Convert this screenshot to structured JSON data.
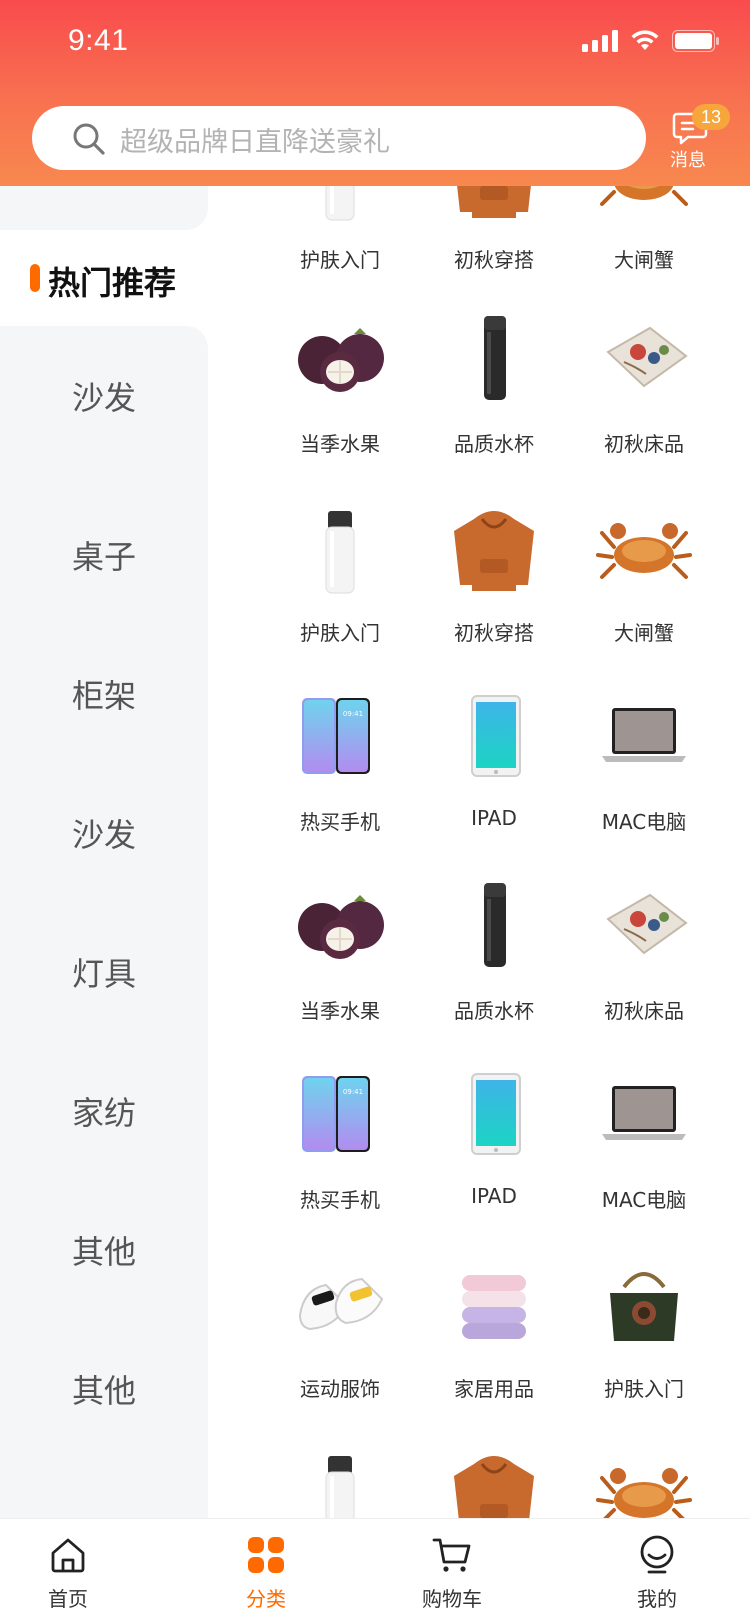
{
  "status_bar": {
    "time": "9:41"
  },
  "search": {
    "placeholder": "超级品牌日直降送豪礼"
  },
  "messages": {
    "label": "消息",
    "badge": "13"
  },
  "sidebar": {
    "active": "热门推荐",
    "items": [
      {
        "label": "沙发"
      },
      {
        "label": "桌子"
      },
      {
        "label": "柜架"
      },
      {
        "label": "沙发"
      },
      {
        "label": "灯具"
      },
      {
        "label": "家纺"
      },
      {
        "label": "其他"
      },
      {
        "label": "其他"
      }
    ]
  },
  "grid": {
    "rows": [
      [
        {
          "name": "护肤入门",
          "icon": "skincare-bottle"
        },
        {
          "name": "初秋穿搭",
          "icon": "hoodie"
        },
        {
          "name": "大闸蟹",
          "icon": "crab"
        }
      ],
      [
        {
          "name": "当季水果",
          "icon": "mangosteen"
        },
        {
          "name": "品质水杯",
          "icon": "thermos"
        },
        {
          "name": "初秋床品",
          "icon": "pillow"
        }
      ],
      [
        {
          "name": "护肤入门",
          "icon": "skincare-bottle"
        },
        {
          "name": "初秋穿搭",
          "icon": "hoodie"
        },
        {
          "name": "大闸蟹",
          "icon": "crab"
        }
      ],
      [
        {
          "name": "热买手机",
          "icon": "phone"
        },
        {
          "name": "IPAD",
          "icon": "tablet"
        },
        {
          "name": "MAC电脑",
          "icon": "laptop"
        }
      ],
      [
        {
          "name": "当季水果",
          "icon": "mangosteen"
        },
        {
          "name": "品质水杯",
          "icon": "thermos"
        },
        {
          "name": "初秋床品",
          "icon": "pillow"
        }
      ],
      [
        {
          "name": "热买手机",
          "icon": "phone"
        },
        {
          "name": "IPAD",
          "icon": "tablet"
        },
        {
          "name": "MAC电脑",
          "icon": "laptop"
        }
      ],
      [
        {
          "name": "运动服饰",
          "icon": "sneakers"
        },
        {
          "name": "家居用品",
          "icon": "towels"
        },
        {
          "name": "护肤入门",
          "icon": "handbag"
        }
      ]
    ]
  },
  "tabbar": {
    "items": [
      {
        "label": "首页",
        "icon": "home-icon"
      },
      {
        "label": "分类",
        "icon": "category-icon"
      },
      {
        "label": "购物车",
        "icon": "cart-icon"
      },
      {
        "label": "我的",
        "icon": "profile-icon"
      }
    ],
    "active": "分类"
  },
  "colors": {
    "accent": "#ff6a00",
    "header_top": "#f94b4d",
    "header_bottom": "#f8884f",
    "sidebar_bg": "#f5f6f8"
  }
}
